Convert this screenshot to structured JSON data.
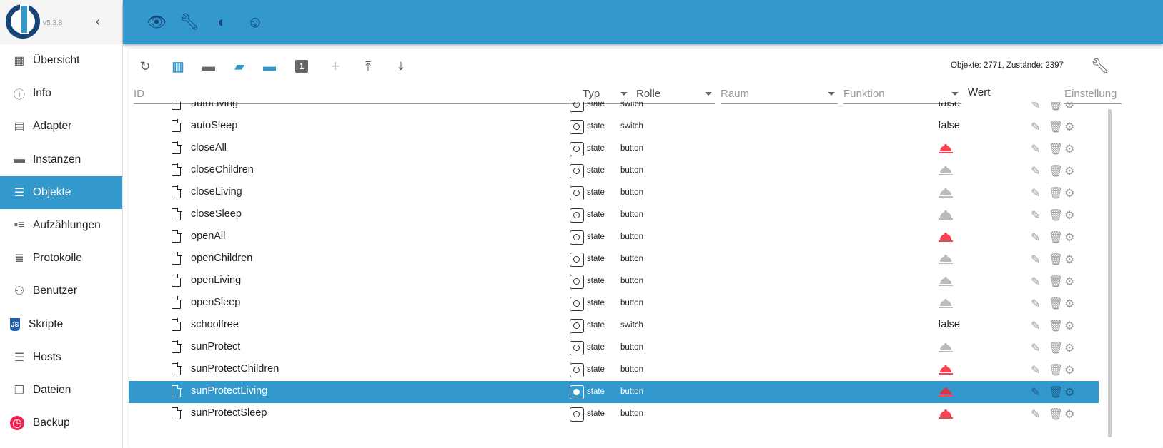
{
  "app": {
    "version": "v5.3.8"
  },
  "sidebar": {
    "items": [
      {
        "label": "Übersicht",
        "icon": "grid-icon",
        "glyph": "▦"
      },
      {
        "label": "Info",
        "icon": "info-icon",
        "glyph": "ⓘ"
      },
      {
        "label": "Adapter",
        "icon": "store-icon",
        "glyph": "▤"
      },
      {
        "label": "Instanzen",
        "icon": "instances-icon",
        "glyph": "▬"
      },
      {
        "label": "Objekte",
        "icon": "list-icon",
        "glyph": "☰",
        "active": true
      },
      {
        "label": "Aufzählungen",
        "icon": "enums-icon",
        "glyph": "▪≡"
      },
      {
        "label": "Protokolle",
        "icon": "logs-icon",
        "glyph": "≣"
      },
      {
        "label": "Benutzer",
        "icon": "user-icon",
        "glyph": "⚇"
      },
      {
        "label": "Skripte",
        "icon": "javascript-icon",
        "glyph": "JS"
      },
      {
        "label": "Hosts",
        "icon": "hosts-icon",
        "glyph": "☰"
      },
      {
        "label": "Dateien",
        "icon": "files-icon",
        "glyph": "❐"
      },
      {
        "label": "Backup",
        "icon": "backup-icon",
        "glyph": "◷"
      }
    ]
  },
  "toolbar": {
    "counts": "Objekte: 2771, Zustände: 2397"
  },
  "columns": {
    "id": "ID",
    "type": "Typ",
    "role": "Rolle",
    "room": "Raum",
    "function": "Funktion",
    "value": "Wert",
    "settings": "Einstellung"
  },
  "rows": [
    {
      "name": "autoLiving",
      "type": "state",
      "role": "switch",
      "value": "false"
    },
    {
      "name": "autoSleep",
      "type": "state",
      "role": "switch",
      "value": "false"
    },
    {
      "name": "closeAll",
      "type": "state",
      "role": "button",
      "bell": "on"
    },
    {
      "name": "closeChildren",
      "type": "state",
      "role": "button",
      "bell": "off"
    },
    {
      "name": "closeLiving",
      "type": "state",
      "role": "button",
      "bell": "off"
    },
    {
      "name": "closeSleep",
      "type": "state",
      "role": "button",
      "bell": "off"
    },
    {
      "name": "openAll",
      "type": "state",
      "role": "button",
      "bell": "on"
    },
    {
      "name": "openChildren",
      "type": "state",
      "role": "button",
      "bell": "off"
    },
    {
      "name": "openLiving",
      "type": "state",
      "role": "button",
      "bell": "off"
    },
    {
      "name": "openSleep",
      "type": "state",
      "role": "button",
      "bell": "off"
    },
    {
      "name": "schoolfree",
      "type": "state",
      "role": "switch",
      "value": "false"
    },
    {
      "name": "sunProtect",
      "type": "state",
      "role": "button",
      "bell": "off"
    },
    {
      "name": "sunProtectChildren",
      "type": "state",
      "role": "button",
      "bell": "on"
    },
    {
      "name": "sunProtectLiving",
      "type": "state",
      "role": "button",
      "bell": "on",
      "selected": true
    },
    {
      "name": "sunProtectSleep",
      "type": "state",
      "role": "button",
      "bell": "on"
    }
  ],
  "colors": {
    "accent": "#3399cc",
    "logo": "#164477",
    "bell_on": "#ff4050",
    "bell_off": "#bbbbbb"
  }
}
